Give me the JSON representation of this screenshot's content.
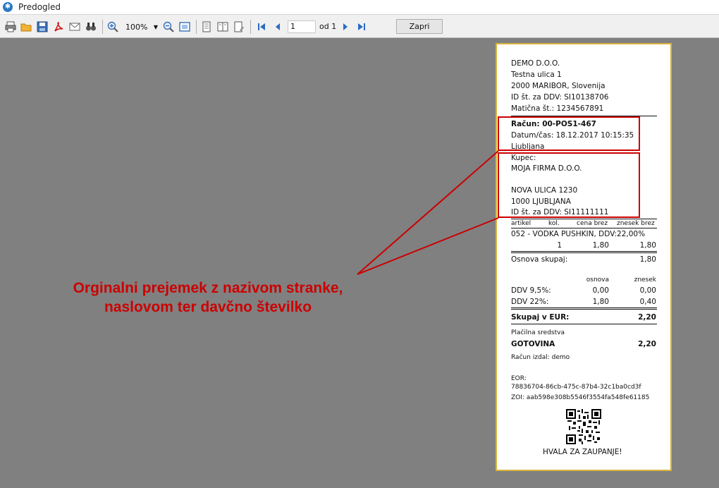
{
  "window": {
    "title": "Predogled"
  },
  "toolbar": {
    "zoom_value": "100%",
    "page_current": "1",
    "page_of": "od 1",
    "close_label": "Zapri"
  },
  "receipt": {
    "company": {
      "name": "DEMO D.O.O.",
      "street": "Testna ulica 1",
      "city": "2000 MARIBOR, Slovenija",
      "vat_id": "ID št. za DDV: SI10138706",
      "reg_no": "Matična št.: 1234567891"
    },
    "invoice": {
      "number": "Račun: 00-POS1-467",
      "datetime": "Datum/čas: 18.12.2017 10:15:35",
      "place": "Ljubljana"
    },
    "customer": {
      "label": "Kupec:",
      "name": "MOJA FIRMA D.O.O.",
      "street": "NOVA ULICA 1230",
      "city": "1000  LJUBLJANA",
      "vat_id": "ID št. za DDV: SI11111111"
    },
    "items_header": {
      "article": "artikel",
      "qty": "kol.",
      "price": "cena brez",
      "total": "znesek brez"
    },
    "items": [
      {
        "name": "052 - VODKA PUSHKIN, DDV:22,00%",
        "qty": "1",
        "price": "1,80",
        "total": "1,80"
      }
    ],
    "base_total_label": "Osnova skupaj:",
    "base_total_value": "1,80",
    "vat_header": {
      "base": "osnova",
      "amount": "znesek"
    },
    "vat_rows": [
      {
        "label": "DDV 9,5%:",
        "base": "0,00",
        "amount": "0,00"
      },
      {
        "label": "DDV 22%:",
        "base": "1,80",
        "amount": "0,40"
      }
    ],
    "total_label": "Skupaj v EUR:",
    "total_value": "2,20",
    "payment_label": "Plačilna sredstva",
    "payment_method": "GOTOVINA",
    "payment_value": "2,20",
    "issued_by": "Račun izdal: demo",
    "eor_label": "EOR:",
    "eor_value": "78836704-86cb-475c-87b4-32c1ba0cd3f",
    "zoi": "ZOI: aab598e308b5546f3554fa548fe61185",
    "thanks": "HVALA ZA ZAUPANJE!"
  },
  "annotation": {
    "line1": "Orginalni prejemek z nazivom stranke,",
    "line2": "naslovom ter davčno številko",
    "color": "#cc0000"
  },
  "colors": {
    "receipt_border": "#d6b43e",
    "viewer_bg": "#808080"
  }
}
